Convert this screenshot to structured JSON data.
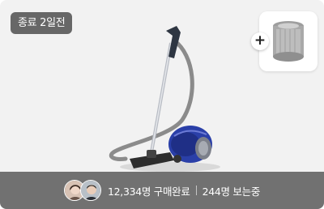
{
  "card": {
    "badge": "종료 2일전",
    "product_icon": "vacuum-cleaner-image",
    "addon_icon": "filter-cylinder-image",
    "plus_symbol": "+"
  },
  "bottom": {
    "purchases": "12,334명 구매완료",
    "viewers": "244명 보는중"
  },
  "colors": {
    "accent_blue": "#2a3fa8",
    "overlay": "#5f5f5f"
  }
}
